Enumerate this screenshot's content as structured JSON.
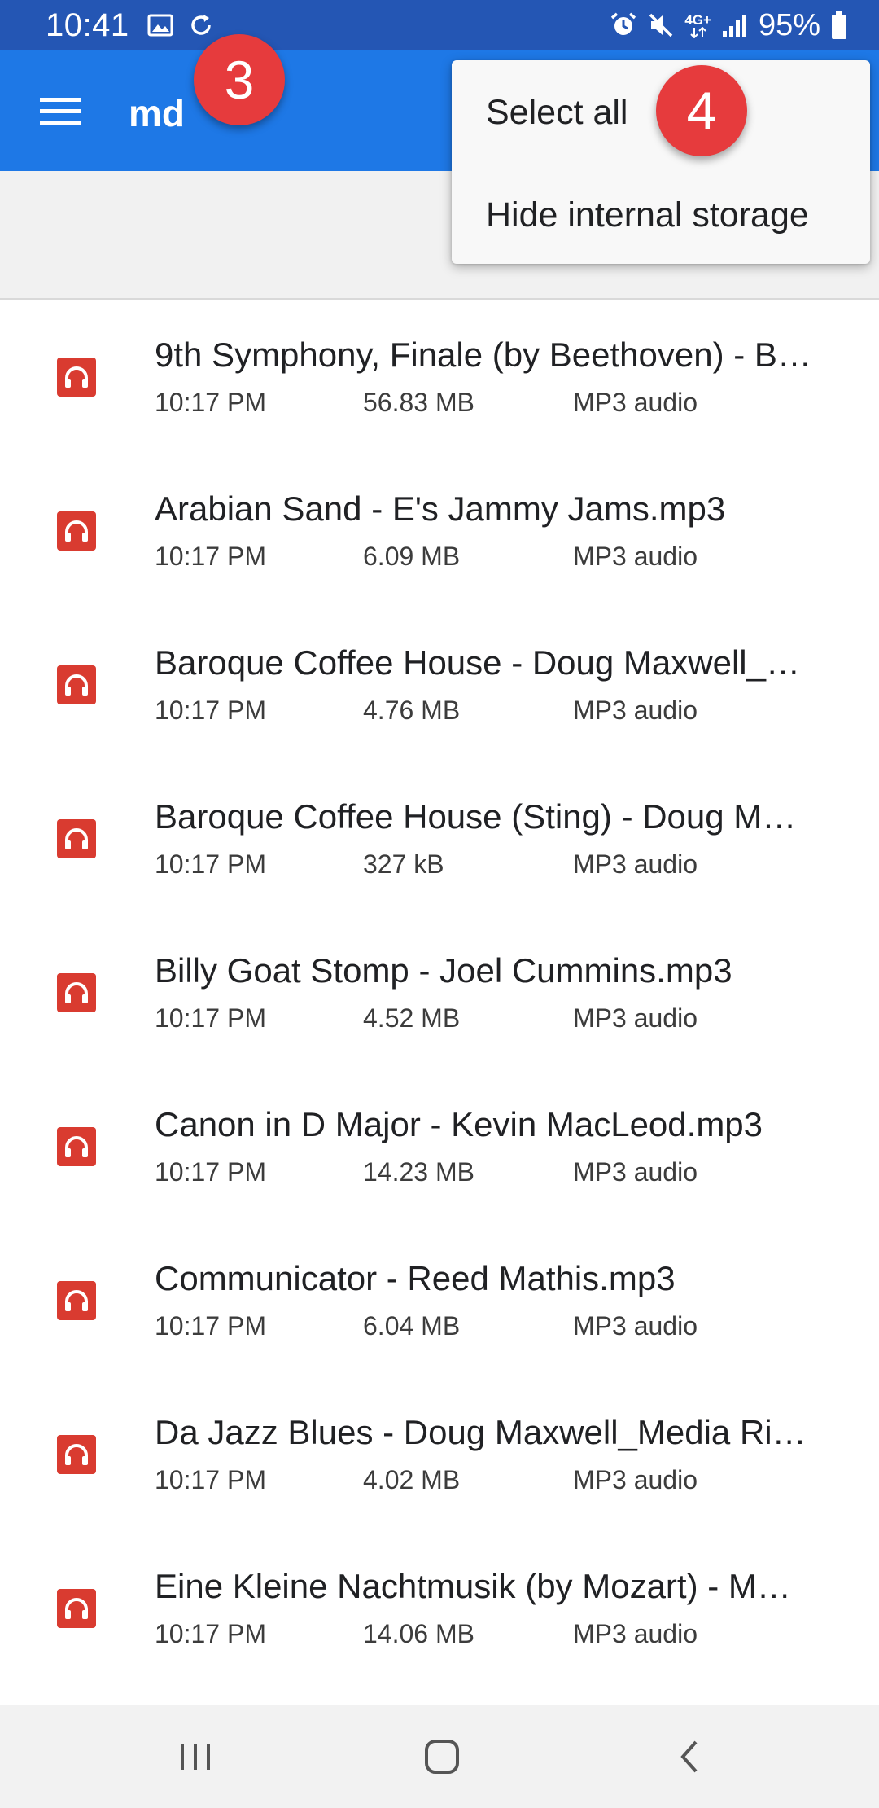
{
  "status_bar": {
    "time": "10:41",
    "network": "4G+",
    "battery": "95%",
    "icons": [
      "gallery-icon",
      "sync-icon",
      "alarm-icon",
      "mute-icon",
      "signal-icon",
      "battery-icon"
    ]
  },
  "app_bar": {
    "title": "md",
    "menu_icon": "hamburger-icon",
    "color": "#1e78e6"
  },
  "overflow_menu": {
    "items": [
      {
        "label": "Select all"
      },
      {
        "label": "Hide internal storage"
      }
    ]
  },
  "badges": {
    "step3": "3",
    "step4": "4",
    "color": "#e63b3d"
  },
  "files": [
    {
      "name": "9th Symphony, Finale (by Beethoven) - B…",
      "time": "10:17 PM",
      "size": "56.83 MB",
      "type": "MP3 audio"
    },
    {
      "name": "Arabian Sand - E's Jammy Jams.mp3",
      "time": "10:17 PM",
      "size": "6.09 MB",
      "type": "MP3 audio"
    },
    {
      "name": "Baroque Coffee House - Doug Maxwell_…",
      "time": "10:17 PM",
      "size": "4.76 MB",
      "type": "MP3 audio"
    },
    {
      "name": "Baroque Coffee House (Sting) - Doug M…",
      "time": "10:17 PM",
      "size": "327 kB",
      "type": "MP3 audio"
    },
    {
      "name": "Billy Goat Stomp - Joel Cummins.mp3",
      "time": "10:17 PM",
      "size": "4.52 MB",
      "type": "MP3 audio"
    },
    {
      "name": "Canon in D Major - Kevin MacLeod.mp3",
      "time": "10:17 PM",
      "size": "14.23 MB",
      "type": "MP3 audio"
    },
    {
      "name": "Communicator - Reed Mathis.mp3",
      "time": "10:17 PM",
      "size": "6.04 MB",
      "type": "MP3 audio"
    },
    {
      "name": "Da Jazz Blues - Doug Maxwell_Media Ri…",
      "time": "10:17 PM",
      "size": "4.02 MB",
      "type": "MP3 audio"
    },
    {
      "name": "Eine Kleine Nachtmusik (by Mozart) - M…",
      "time": "10:17 PM",
      "size": "14.06 MB",
      "type": "MP3 audio"
    }
  ],
  "file_icon": {
    "name": "headphones-icon",
    "color": "#d93b30"
  },
  "nav_bar": {
    "icons": [
      "recent-apps-icon",
      "home-icon",
      "back-icon"
    ]
  }
}
